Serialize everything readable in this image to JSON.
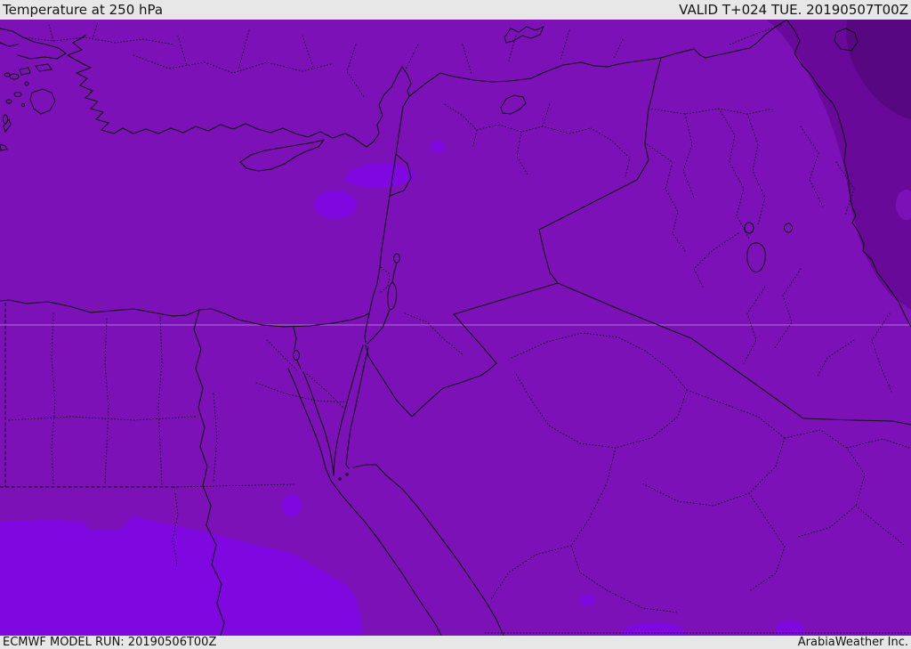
{
  "header": {
    "title": "Temperature at 250 hPa",
    "valid_label": "VALID T+024 TUE. 20190507T00Z"
  },
  "footer": {
    "model_run_label": "ECMWF MODEL RUN: 20190506T00Z",
    "credit_label": "ArabiaWeather Inc."
  },
  "map": {
    "parameter": "Temperature",
    "level": "250 hPa",
    "region": "Middle East / Eastern Mediterranean",
    "shading_legend": [
      {
        "name": "base-purple",
        "meaning": "main temperature band"
      },
      {
        "name": "bright-violet",
        "meaning": "colder pockets (Cyprus coast, south Egypt, Red Sea coast)"
      },
      {
        "name": "dark-purple",
        "meaning": "warmer band over Zagros / north-east corner"
      }
    ],
    "colors": {
      "base": "#7d11b8",
      "bright": "#7f07df",
      "dark": "#68099a",
      "darker": "#570780",
      "coastline": "#0d0d0d",
      "bar_bg": "#e7e7e7",
      "bar_text": "#141414",
      "graticule": "#cdb6e0"
    }
  }
}
